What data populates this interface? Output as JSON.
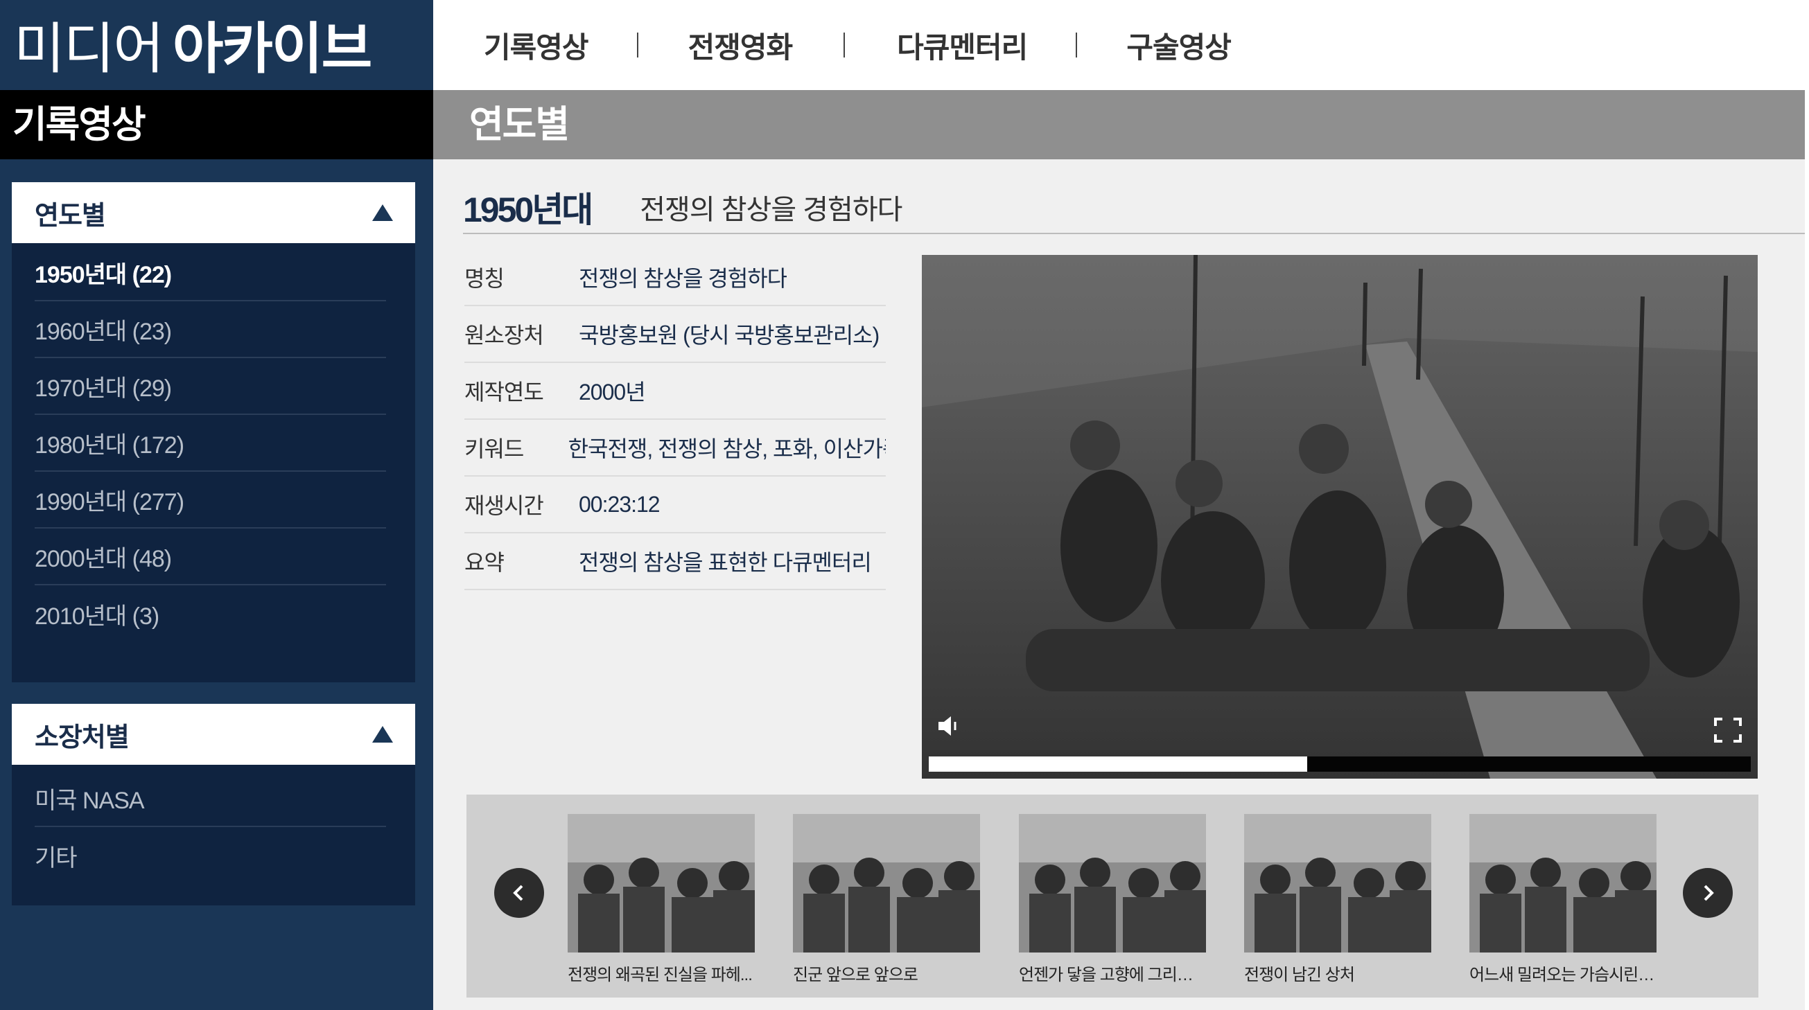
{
  "logo": {
    "thin": "미디어",
    "bold": "아카이브"
  },
  "sidebar": {
    "title": "기록영상",
    "panels": [
      {
        "label": "연도별",
        "items": [
          "1950년대  (22)",
          "1960년대 (23)",
          "1970년대 (29)",
          "1980년대 (172)",
          "1990년대 (277)",
          "2000년대 (48)",
          "2010년대 (3)"
        ],
        "active_index": 0
      },
      {
        "label": "소장처별",
        "items": [
          "미국 NASA",
          "기타"
        ]
      }
    ]
  },
  "topnav": {
    "items": [
      "기록영상",
      "전쟁영화",
      "다큐멘터리",
      "구술영상"
    ]
  },
  "banner": {
    "title": "연도별"
  },
  "content": {
    "era": "1950년대",
    "subtitle": "전쟁의 참상을 경험하다",
    "info": [
      {
        "key": "명칭",
        "value": "전쟁의 참상을 경험하다"
      },
      {
        "key": "원소장처",
        "value": "국방홍보원 (당시 국방홍보관리소)"
      },
      {
        "key": "제작연도",
        "value": "2000년"
      },
      {
        "key": "키워드",
        "value": "한국전쟁, 전쟁의 참상, 포화, 이산가족..."
      },
      {
        "key": "재생시간",
        "value": "00:23:12"
      },
      {
        "key": "요약",
        "value": "전쟁의 참상을 표현한 다큐멘터리"
      }
    ]
  },
  "player": {
    "progress": 0.46,
    "icons": {
      "volume": "volume-icon",
      "fullscreen": "fullscreen-icon"
    }
  },
  "thumbnails": [
    {
      "caption": "전쟁의 왜곡된 진실을 파헤..."
    },
    {
      "caption": "진군 앞으로 앞으로"
    },
    {
      "caption": "언젠가 닿을 고향에 그리움을 ..."
    },
    {
      "caption": "전쟁이 남긴 상처"
    },
    {
      "caption": "어느새 밀려오는 가슴시린 기억"
    }
  ],
  "colors": {
    "sidebar": "#1a3656",
    "panel": "#0f2340",
    "banner": "#8f8f8f",
    "accent": "#1a2d4a"
  }
}
